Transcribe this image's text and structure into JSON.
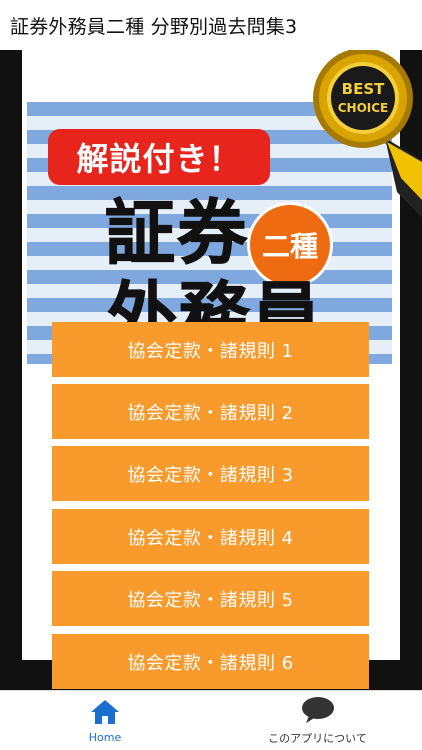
{
  "app_bar": {
    "title": "証券外務員二種 分野別過去問集3"
  },
  "banner": {
    "tag": "解説付き！",
    "title_line1": "証券",
    "title_line2": "外務員",
    "circle": "二種",
    "badge_line1": "BEST",
    "badge_line2": "CHOICE"
  },
  "menu": {
    "items": [
      {
        "label": "協会定款・諸規則 1"
      },
      {
        "label": "協会定款・諸規則 2"
      },
      {
        "label": "協会定款・諸規則 3"
      },
      {
        "label": "協会定款・諸規則 4"
      },
      {
        "label": "協会定款・諸規則 5"
      },
      {
        "label": "協会定款・諸規則 6"
      }
    ]
  },
  "bottom_nav": {
    "home": {
      "label": "Home",
      "icon": "home-icon"
    },
    "about": {
      "label": "このアプリについて",
      "icon": "chat-bubble-icon"
    }
  },
  "colors": {
    "accent": "#f99a2c",
    "tag_red": "#e8251d",
    "circle_orange": "#ef6b12",
    "nav_active": "#1a6fcf"
  }
}
